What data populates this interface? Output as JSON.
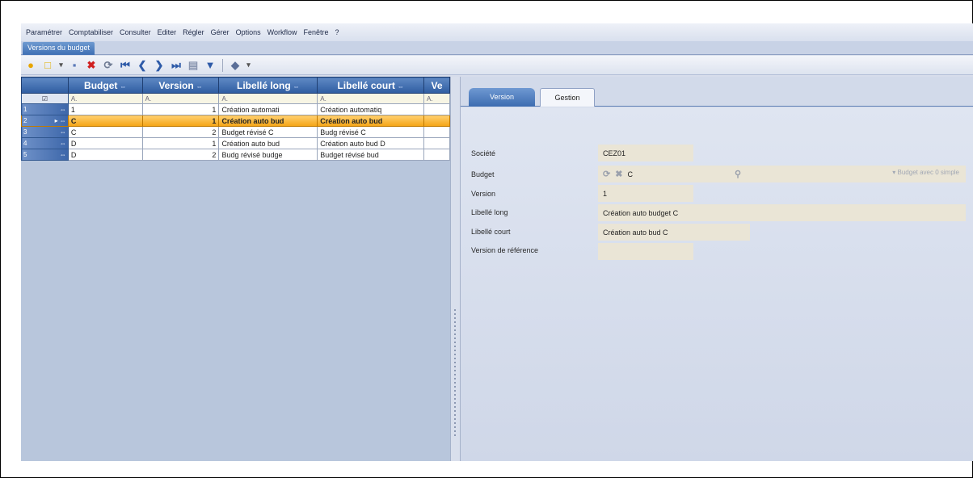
{
  "menu": [
    "Paramétrer",
    "Comptabiliser",
    "Consulter",
    "Editer",
    "Régler",
    "Gérer",
    "Options",
    "Workflow",
    "Fenêtre",
    "?"
  ],
  "window_tab": "Versions du budget",
  "toolbar_icons": [
    "open-folder-icon",
    "new-icon",
    "save-icon",
    "delete-icon",
    "refresh-icon",
    "first-record-icon",
    "previous-record-icon",
    "next-record-icon",
    "last-record-icon",
    "print-icon",
    "filter-icon",
    "export-icon"
  ],
  "grid": {
    "columns": [
      {
        "label": "Budget",
        "sort": "⇔"
      },
      {
        "label": "Version",
        "sort": "⇔"
      },
      {
        "label": "Libellé long",
        "sort": "⇔"
      },
      {
        "label": "Libellé court",
        "sort": "⇔"
      },
      {
        "label": "Ve",
        "sort": ""
      }
    ],
    "filter_cells": [
      "A.",
      "A.",
      "A.",
      "A.",
      "A."
    ],
    "rows": [
      {
        "num": "1",
        "marker": "⇔",
        "budget": "1",
        "version": "1",
        "long": "Création automati",
        "short": "Création automatiq",
        "selected": false
      },
      {
        "num": "2",
        "marker": "▸ ⇔",
        "budget": "C",
        "version": "1",
        "long": "Création auto bud",
        "short": "Création auto bud",
        "selected": true
      },
      {
        "num": "3",
        "marker": "⇔",
        "budget": "C",
        "version": "2",
        "long": "Budget révisé C",
        "short": "Budg révisé  C",
        "selected": false
      },
      {
        "num": "4",
        "marker": "⇔",
        "budget": "D",
        "version": "1",
        "long": "Création auto bud",
        "short": "Création auto bud D",
        "selected": false
      },
      {
        "num": "5",
        "marker": "⇔",
        "budget": "D",
        "version": "2",
        "long": "Budg révisé budge",
        "short": "Budget révisé bud",
        "selected": false
      }
    ]
  },
  "detail": {
    "tabs": {
      "version": "Version",
      "gestion": "Gestion"
    },
    "labels": {
      "societe": "Société",
      "budget": "Budget",
      "version": "Version",
      "libelle_long": "Libellé long",
      "libelle_court": "Libellé court",
      "version_reference": "Version de référence"
    },
    "values": {
      "societe": "CEZ01",
      "budget": "C",
      "version": "1",
      "libelle_long": "Création auto budget C",
      "libelle_court": "Création auto bud C",
      "version_reference": ""
    },
    "budget_lookup_hint": "▾  Budget avec 0 simple"
  },
  "colors": {
    "header_blue": "#3e6fb4",
    "selected_row": "#f4a414",
    "field_bg": "#eae5d6",
    "panel_bg": "#d2daea"
  }
}
